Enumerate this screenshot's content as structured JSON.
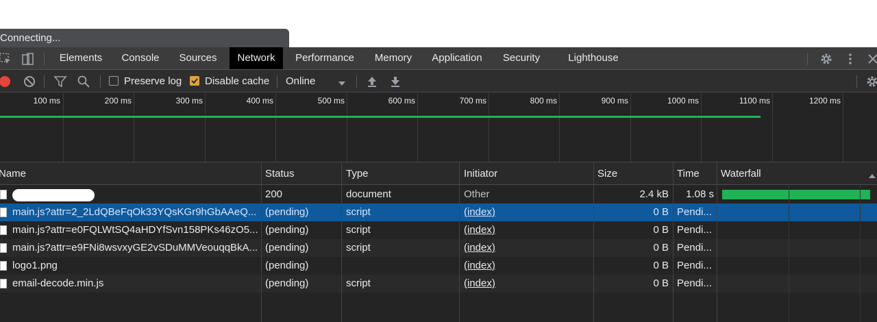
{
  "status_bubble": "Connecting...",
  "tabs": [
    {
      "label": "Elements"
    },
    {
      "label": "Console"
    },
    {
      "label": "Sources"
    },
    {
      "label": "Network",
      "active": true
    },
    {
      "label": "Performance"
    },
    {
      "label": "Memory"
    },
    {
      "label": "Application"
    },
    {
      "label": "Security"
    },
    {
      "label": "Lighthouse"
    }
  ],
  "toolbar": {
    "preserve_log_label": "Preserve log",
    "preserve_log_checked": false,
    "disable_cache_label": "Disable cache",
    "disable_cache_checked": true,
    "throttle_value": "Online"
  },
  "overview": {
    "ticks": [
      "100 ms",
      "200 ms",
      "300 ms",
      "400 ms",
      "500 ms",
      "600 ms",
      "700 ms",
      "800 ms",
      "900 ms",
      "1000 ms",
      "1100 ms",
      "1200 ms"
    ]
  },
  "table": {
    "headers": {
      "name": "Name",
      "status": "Status",
      "type": "Type",
      "initiator": "Initiator",
      "size": "Size",
      "time": "Time",
      "waterfall": "Waterfall"
    },
    "rows": [
      {
        "name": "",
        "status": "200",
        "type": "document",
        "initiator": "Other",
        "size": "2.4 kB",
        "time": "1.08 s"
      },
      {
        "name": "main.js?attr=2_2LdQBeFqOk33YQsKGr9hGbAAeQ...",
        "status": "(pending)",
        "type": "script",
        "initiator": "(index)",
        "size": "0 B",
        "time": "Pendi..."
      },
      {
        "name": "main.js?attr=e0FQLWtSQ4aHDYfSvn158PKs46zO5...",
        "status": "(pending)",
        "type": "script",
        "initiator": "(index)",
        "size": "0 B",
        "time": "Pendi..."
      },
      {
        "name": "main.js?attr=e9FNi8wsvxyGE2vSDuMMVeouqqBkA...",
        "status": "(pending)",
        "type": "script",
        "initiator": "(index)",
        "size": "0 B",
        "time": "Pendi..."
      },
      {
        "name": "logo1.png",
        "status": "(pending)",
        "type": "",
        "initiator": "(index)",
        "size": "0 B",
        "time": "Pendi..."
      },
      {
        "name": "email-decode.min.js",
        "status": "(pending)",
        "type": "script",
        "initiator": "(index)",
        "size": "0 B",
        "time": "Pendi..."
      }
    ]
  },
  "colors": {
    "accent_record": "#e8453c",
    "checkbox_checked": "#e0a33b",
    "selection": "#0f5a9c",
    "waterfall_bar": "#1fb356"
  }
}
